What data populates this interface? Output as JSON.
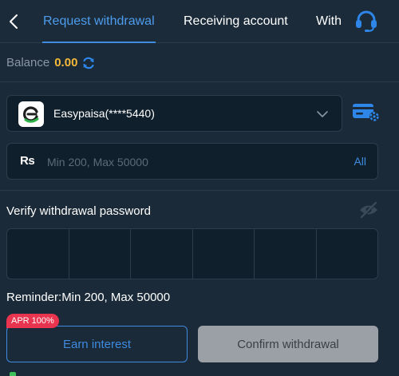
{
  "header": {
    "tabs": [
      {
        "label": "Request withdrawal",
        "active": true
      },
      {
        "label": "Receiving account",
        "active": false
      },
      {
        "label": "With",
        "active": false
      }
    ]
  },
  "balance": {
    "label": "Balance",
    "value": "0.00"
  },
  "account": {
    "name": "Easypaisa(****5440)"
  },
  "amount": {
    "currency": "Rs",
    "placeholder": "Min 200, Max 50000",
    "all_label": "All"
  },
  "password": {
    "title": "Verify withdrawal password",
    "digits": 6
  },
  "reminder": "Reminder:Min 200, Max 50000",
  "buttons": {
    "apr_badge": "APR 100%",
    "earn": "Earn interest",
    "confirm": "Confirm withdrawal"
  },
  "colors": {
    "accent": "#3e8be0",
    "balance": "#f5b83a",
    "badge": "#e8344e",
    "background": "#1a2a38"
  }
}
